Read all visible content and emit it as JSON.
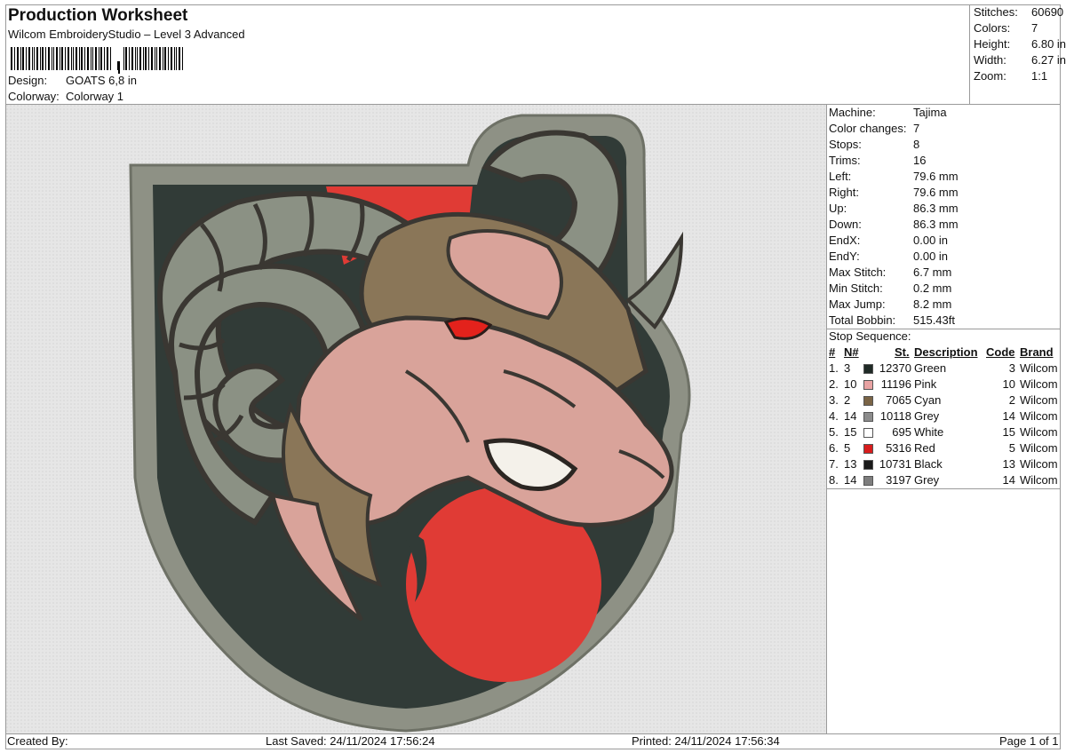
{
  "header": {
    "title": "Production Worksheet",
    "subtitle": "Wilcom EmbroideryStudio – Level 3 Advanced",
    "design_label": "Design:",
    "design_value": "GOATS 6,8 in",
    "colorway_label": "Colorway:",
    "colorway_value": "Colorway 1"
  },
  "summary": [
    {
      "label": "Stitches:",
      "value": "60690"
    },
    {
      "label": "Colors:",
      "value": "7"
    },
    {
      "label": "Height:",
      "value": "6.80 in"
    },
    {
      "label": "Width:",
      "value": "6.27 in"
    },
    {
      "label": "Zoom:",
      "value": "1:1"
    }
  ],
  "machine_info": [
    {
      "label": "Machine:",
      "value": "Tajima"
    },
    {
      "label": "Color changes:",
      "value": "7"
    },
    {
      "label": "Stops:",
      "value": "8"
    },
    {
      "label": "Trims:",
      "value": "16"
    },
    {
      "label": "Left:",
      "value": "79.6 mm"
    },
    {
      "label": "Right:",
      "value": "79.6 mm"
    },
    {
      "label": "Up:",
      "value": "86.3 mm"
    },
    {
      "label": "Down:",
      "value": "86.3 mm"
    },
    {
      "label": "EndX:",
      "value": "0.00 in"
    },
    {
      "label": "EndY:",
      "value": "0.00 in"
    },
    {
      "label": "Max Stitch:",
      "value": "6.7 mm"
    },
    {
      "label": "Min Stitch:",
      "value": "0.2 mm"
    },
    {
      "label": "Max Jump:",
      "value": "8.2 mm"
    },
    {
      "label": "Total Bobbin:",
      "value": "515.43ft"
    }
  ],
  "stop_sequence": {
    "title": "Stop Sequence:",
    "columns": {
      "num": "#",
      "n": "N#",
      "st": "St.",
      "description": "Description",
      "code": "Code",
      "brand": "Brand"
    },
    "rows": [
      {
        "num": "1.",
        "n": "3",
        "st": "12370",
        "description": "Green",
        "code": "3",
        "brand": "Wilcom",
        "color": "#1f2a26"
      },
      {
        "num": "2.",
        "n": "10",
        "st": "11196",
        "description": "Pink",
        "code": "10",
        "brand": "Wilcom",
        "color": "#e8a3a3"
      },
      {
        "num": "3.",
        "n": "2",
        "st": "7065",
        "description": "Cyan",
        "code": "2",
        "brand": "Wilcom",
        "color": "#7a6446"
      },
      {
        "num": "4.",
        "n": "14",
        "st": "10118",
        "description": "Grey",
        "code": "14",
        "brand": "Wilcom",
        "color": "#8c8c8c"
      },
      {
        "num": "5.",
        "n": "15",
        "st": "695",
        "description": "White",
        "code": "15",
        "brand": "Wilcom",
        "color": "#ffffff"
      },
      {
        "num": "6.",
        "n": "5",
        "st": "5316",
        "description": "Red",
        "code": "5",
        "brand": "Wilcom",
        "color": "#d81c1c"
      },
      {
        "num": "7.",
        "n": "13",
        "st": "10731",
        "description": "Black",
        "code": "13",
        "brand": "Wilcom",
        "color": "#1a1a1a"
      },
      {
        "num": "8.",
        "n": "14",
        "st": "3197",
        "description": "Grey",
        "code": "14",
        "brand": "Wilcom",
        "color": "#7d7d7d"
      }
    ]
  },
  "footer": {
    "created_by": "Created By:",
    "last_saved": "Last Saved: 24/11/2024 17:56:24",
    "printed": "Printed: 24/11/2024 17:56:34",
    "page": "Page 1 of 1"
  },
  "design_colors": {
    "shield_border": "#8e9185",
    "shield_fill": "#313b37",
    "red": "#e03b35",
    "horn": "#8b9184",
    "horn_outline": "#3a3732",
    "face": "#d9a39a",
    "fur": "#8a7658",
    "eye": "#e3221c"
  }
}
